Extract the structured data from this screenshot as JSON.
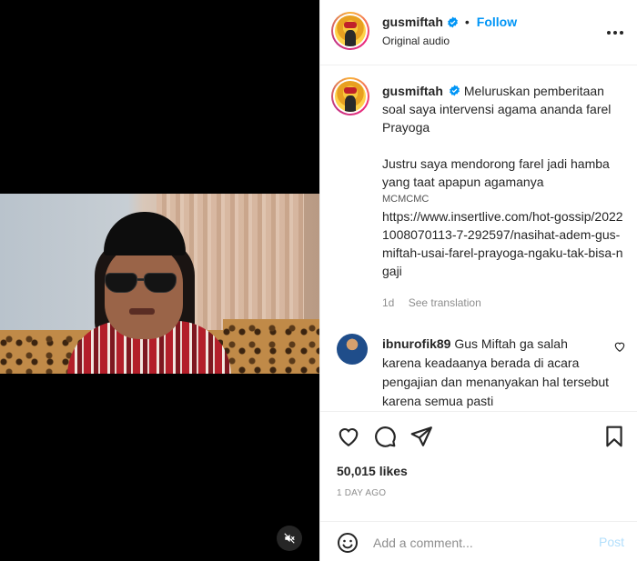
{
  "post": {
    "username": "gusmiftah",
    "follow_label": "Follow",
    "dot": "•",
    "audio": "Original audio"
  },
  "caption": {
    "username": "gusmiftah",
    "line1": "Meluruskan pemberitaan soal saya intervensi agama ananda farel Prayoga",
    "line2": "Justru saya mendorong farel jadi hamba yang taat apapun agamanya",
    "tag": "MCMCMC",
    "link": "https://www.insertlive.com/hot-gossip/20221008070113-7-292597/nasihat-adem-gus-miftah-usai-farel-prayoga-ngaku-tak-bisa-ngaji",
    "age": "1d",
    "see_translation": "See translation"
  },
  "comment": {
    "username": "ibnurofik89",
    "text": "Gus Miftah ga salah karena keadaanya berada di acara pengajian dan menanyakan hal tersebut karena semua pasti"
  },
  "stats": {
    "likes": "50,015 likes",
    "time": "1 DAY AGO"
  },
  "add_comment": {
    "placeholder": "Add a comment...",
    "post_label": "Post"
  },
  "colors": {
    "accent": "#0095f6",
    "post_disabled": "#b2dffc",
    "verified": "#0095f6"
  },
  "icons": [
    "verified-badge-icon",
    "more-icon",
    "heart-icon",
    "comment-icon",
    "share-icon",
    "bookmark-icon",
    "emoji-icon",
    "muted-speaker-icon"
  ]
}
